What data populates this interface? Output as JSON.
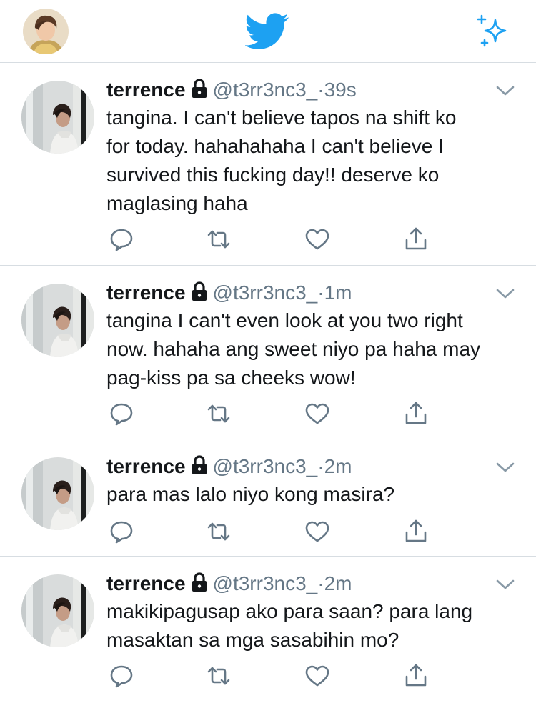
{
  "nav": {
    "avatar_icon": "profile-avatar",
    "logo_icon": "twitter-bird-icon",
    "sparkle_icon": "sparkle-icon",
    "accent_color": "#1da1f2"
  },
  "tweets": [
    {
      "name": "terrence",
      "handle": "@t3rr3nc3_",
      "separator": "·",
      "time": "39s",
      "lines": [
        "tangina. I can't believe tapos na shift ko",
        "for today. hahahahaha I can't believe I",
        "survived this fucking day!! deserve ko",
        "maglasing haha"
      ]
    },
    {
      "name": "terrence",
      "handle": "@t3rr3nc3_",
      "separator": "·",
      "time": "1m",
      "lines": [
        "tangina I can't even look at you two right",
        "now. hahaha ang sweet niyo pa haha may",
        "pag-kiss pa sa cheeks wow!"
      ]
    },
    {
      "name": "terrence",
      "handle": "@t3rr3nc3_",
      "separator": "·",
      "time": "2m",
      "lines": [
        "para mas lalo niyo kong masira?"
      ]
    },
    {
      "name": "terrence",
      "handle": "@t3rr3nc3_",
      "separator": "·",
      "time": "2m",
      "lines": [
        "makikipagusap ako para saan? para lang",
        "masaktan sa mga sasabihin mo?"
      ]
    }
  ],
  "colors": {
    "text": "#14171a",
    "secondary": "#657786",
    "divider": "#d7dde2"
  }
}
